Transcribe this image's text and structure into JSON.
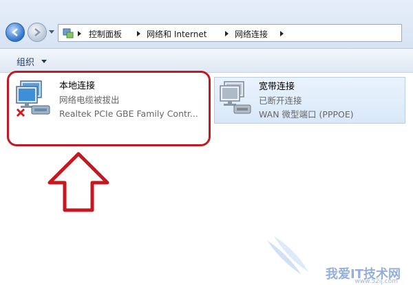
{
  "breadcrumb": [
    "控制面板",
    "网络和 Internet",
    "网络连接"
  ],
  "toolbar": {
    "organize_label": "组织"
  },
  "connections": [
    {
      "name": "本地连接",
      "status": "网络电缆被拔出",
      "device": "Realtek PCIe GBE Family Contr..."
    },
    {
      "name": "宽带连接",
      "status": "已断开连接",
      "device": "WAN 微型端口 (PPPOE)"
    }
  ],
  "watermark": {
    "text": "我爱IT技术网",
    "url": "www.52ij.com"
  },
  "colors": {
    "highlight": "#c4171f",
    "selected_bg": "#dceafa"
  }
}
